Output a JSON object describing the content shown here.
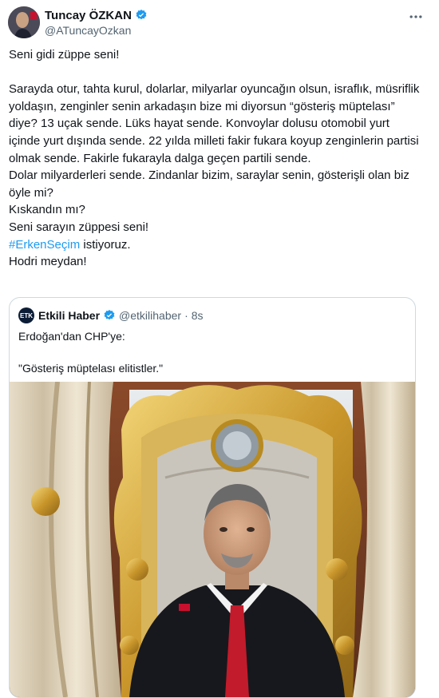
{
  "author": {
    "display_name": "Tuncay ÖZKAN",
    "handle": "@ATuncayOzkan"
  },
  "tweet": {
    "lines": [
      "Seni gidi züppe seni!",
      "",
      "Sarayda otur, tahta kurul, dolarlar, milyarlar oyuncağın olsun, israflık, müsriflik yoldaşın, zenginler senin arkadaşın bize mi diyorsun “gösteriş müptelası” diye? 13 uçak sende. Lüks hayat sende. Konvoylar dolusu otomobil yurt içinde yurt dışında sende. 22 yılda milleti fakir fukara koyup zenginlerin partisi olmak sende. Fakirle fukarayla dalga geçen partili sende.",
      "Dolar milyarderleri sende. Zindanlar bizim, saraylar senin, gösterişli olan biz öyle mi?",
      "Kıskandın mı?",
      "Seni sarayın züppesi seni!"
    ],
    "hashtag": "#ErkenSeçim",
    "hashtag_suffix": " istiyoruz.",
    "closing": "Hodri meydan!"
  },
  "quote": {
    "avatar_text": "ETK",
    "display_name": "Etkili Haber",
    "handle": "@etkilihaber",
    "separator": "·",
    "time": "8s",
    "line1": "Erdoğan'dan CHP'ye:",
    "line2": "\"Gösteriş müptelası elitistler.\""
  },
  "icons": {
    "verified": "verified-badge-icon",
    "more": "more-icon"
  },
  "colors": {
    "accent": "#1d9bf0",
    "text": "#0f1419",
    "muted": "#536471",
    "border": "#cfd9de",
    "gold": "#d4a93a"
  }
}
